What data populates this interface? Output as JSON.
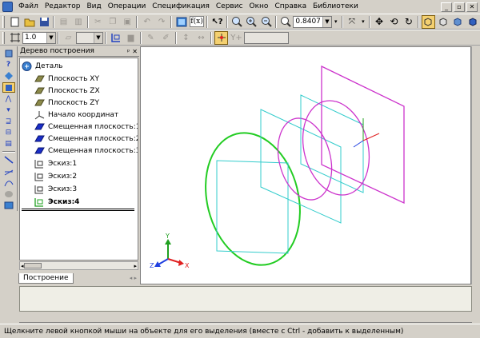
{
  "menu": {
    "items": [
      "Файл",
      "Редактор",
      "Вид",
      "Операции",
      "Спецификация",
      "Сервис",
      "Окно",
      "Справка",
      "Библиотеки"
    ]
  },
  "toolbar": {
    "zoom_value": "0.8407",
    "step_value": "1.0"
  },
  "tree": {
    "title": "Дерево построения",
    "root": "Деталь",
    "items": [
      {
        "label": "Плоскость XY",
        "icon": "plane-icon"
      },
      {
        "label": "Плоскость ZX",
        "icon": "plane-icon"
      },
      {
        "label": "Плоскость ZY",
        "icon": "plane-icon"
      },
      {
        "label": "Начало координат",
        "icon": "origin-icon"
      },
      {
        "label": "Смещенная плоскость:1",
        "icon": "offset-plane-icon"
      },
      {
        "label": "Смещенная плоскость:2",
        "icon": "offset-plane-icon"
      },
      {
        "label": "Смещенная плоскость:3",
        "icon": "offset-plane-icon"
      },
      {
        "label": "Эскиз:1",
        "icon": "sketch-icon"
      },
      {
        "label": "Эскиз:2",
        "icon": "sketch-icon"
      },
      {
        "label": "Эскиз:3",
        "icon": "sketch-icon"
      },
      {
        "label": "Эскиз:4",
        "icon": "sketch-active-icon"
      }
    ],
    "tab_label": "Построение"
  },
  "axes": {
    "x": "X",
    "y": "Y",
    "z": "Z"
  },
  "colors": {
    "sketch1": "#22cc22",
    "sketch_cyan": "#33cccc",
    "sketch_magenta": "#cc33cc",
    "axis_x": "#e02020",
    "axis_y": "#20a020",
    "axis_z": "#2040e0"
  },
  "status": {
    "text": "Щелкните левой кнопкой мыши на объекте для его выделения (вместе с Ctrl - добавить к выделенным)"
  }
}
